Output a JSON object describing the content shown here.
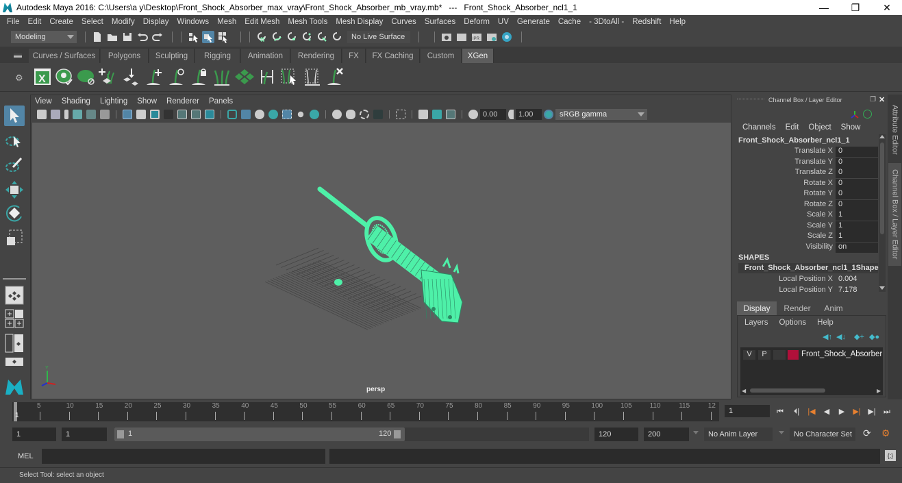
{
  "titlebar": {
    "title": "Autodesk Maya 2016: C:\\Users\\a y\\Desktop\\Front_Shock_Absorber_max_vray\\Front_Shock_Absorber_mb_vray.mb*   ---   Front_Shock_Absorber_ncl1_1",
    "minimize": "—",
    "restore": "❐",
    "close": "✕"
  },
  "menubar": [
    "File",
    "Edit",
    "Create",
    "Select",
    "Modify",
    "Display",
    "Windows",
    "Mesh",
    "Edit Mesh",
    "Mesh Tools",
    "Mesh Display",
    "Curves",
    "Surfaces",
    "Deform",
    "UV",
    "Generate",
    "Cache",
    "- 3DtoAll -",
    "Redshift",
    "Help"
  ],
  "statusline": {
    "menuset": "Modeling",
    "live_surface": "No Live Surface"
  },
  "shelf": {
    "tabs": [
      "Curves / Surfaces",
      "Polygons",
      "Sculpting",
      "Rigging",
      "Animation",
      "Rendering",
      "FX",
      "FX Caching",
      "Custom",
      "XGen"
    ],
    "active_tab": "XGen",
    "icons": [
      "xgen-window-icon",
      "xgen-preview-icon",
      "xgen-hide-icon",
      "xgen-add-guide-icon",
      "xgen-place-icon",
      "xgen-add-icon",
      "xgen-sculpt-icon",
      "xgen-lock-icon",
      "xgen-guides-icon",
      "xgen-patches-icon",
      "xgen-length-icon",
      "xgen-select-icon",
      "xgen-rebuild-icon",
      "xgen-delete-icon"
    ]
  },
  "viewport": {
    "menu": [
      "View",
      "Shading",
      "Lighting",
      "Show",
      "Renderer",
      "Panels"
    ],
    "exposure": "0.00",
    "gamma": "1.00",
    "color_space": "sRGB gamma",
    "camera_label": "persp",
    "wire_color": "#4ef0a8"
  },
  "channel_box": {
    "title": "Channel Box / Layer Editor",
    "menu": [
      "Channels",
      "Edit",
      "Object",
      "Show"
    ],
    "object_name": "Front_Shock_Absorber_ncl1_1",
    "channels": [
      {
        "label": "Translate X",
        "value": "0"
      },
      {
        "label": "Translate Y",
        "value": "0"
      },
      {
        "label": "Translate Z",
        "value": "0"
      },
      {
        "label": "Rotate X",
        "value": "0"
      },
      {
        "label": "Rotate Y",
        "value": "0"
      },
      {
        "label": "Rotate Z",
        "value": "0"
      },
      {
        "label": "Scale X",
        "value": "1"
      },
      {
        "label": "Scale Y",
        "value": "1"
      },
      {
        "label": "Scale Z",
        "value": "1"
      },
      {
        "label": "Visibility",
        "value": "on"
      }
    ],
    "shapes_header": "SHAPES",
    "shape_name": "Front_Shock_Absorber_ncl1_1Shape",
    "shape_channels": [
      {
        "label": "Local Position X",
        "value": "0.004"
      },
      {
        "label": "Local Position Y",
        "value": "7.178"
      }
    ]
  },
  "side_tabs": [
    "Attribute Editor",
    "Channel Box / Layer Editor"
  ],
  "layer_editor": {
    "tabs": [
      "Display",
      "Render",
      "Anim"
    ],
    "active_tab": "Display",
    "menu": [
      "Layers",
      "Options",
      "Help"
    ],
    "layers": [
      {
        "v": "V",
        "p": "P",
        "color": "#b0103a",
        "name": "Front_Shock_Absorber"
      }
    ]
  },
  "timeline": {
    "ticks": [
      "5",
      "10",
      "15",
      "20",
      "25",
      "30",
      "35",
      "40",
      "45",
      "50",
      "55",
      "60",
      "65",
      "70",
      "75",
      "80",
      "85",
      "90",
      "95",
      "100",
      "105",
      "110",
      "115",
      "12"
    ],
    "current_frame_marker": "1",
    "current_frame": "1"
  },
  "range": {
    "start": "1",
    "playback_start": "1",
    "slider_start": "1",
    "slider_end": "120",
    "playback_end": "120",
    "end": "200",
    "anim_layer": "No Anim Layer",
    "character_set": "No Character Set"
  },
  "command_line": {
    "label": "MEL"
  },
  "help_line": "Select Tool: select an object"
}
